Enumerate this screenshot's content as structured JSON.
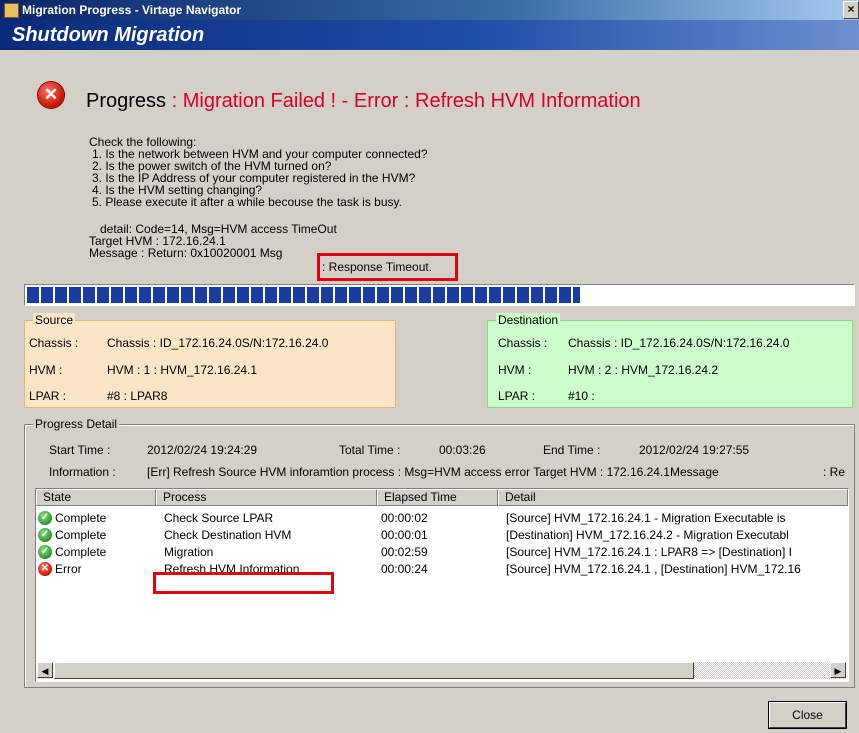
{
  "window": {
    "title": "Migration Progress - Virtage Navigator",
    "close_glyph": "×"
  },
  "banner": {
    "title": "Shutdown Migration"
  },
  "status": {
    "label": "Progress",
    "separator": ":",
    "text": "Migration Failed ! - Error : Refresh HVM Information",
    "error_color": "#d8002a"
  },
  "checklist": {
    "heading": "Check the following:",
    "items": [
      "1. Is the network between HVM and your computer connected?",
      "2. Is the power switch of the HVM turned on?",
      "3. Is the IP Address of your computer registered in the HVM?",
      "4. Is the HVM setting changing?",
      "5. Please execute it after a while becouse the task is busy."
    ]
  },
  "error_detail": {
    "detail": "detail:  Code=14, Msg=HVM access TimeOut",
    "target_hvm": "Target HVM : 172.16.24.1",
    "message_prefix": "Message    : Return: 0x10020001 Msg",
    "message_highlight": ": Response Timeout."
  },
  "progress_bar": {
    "fraction": 0.67,
    "color": "#1a3ba0"
  },
  "source": {
    "legend": "Source",
    "chassis_label": "Chassis :",
    "chassis_value": "Chassis : ID_172.16.24.0S/N:172.16.24.0",
    "hvm_label": "HVM :",
    "hvm_value": "HVM : 1 : HVM_172.16.24.1",
    "lpar_label": "LPAR :",
    "lpar_value": "#8 : LPAR8",
    "bg_color": "#fde6c8"
  },
  "destination": {
    "legend": "Destination",
    "chassis_label": "Chassis :",
    "chassis_value": "Chassis : ID_172.16.24.0S/N:172.16.24.0",
    "hvm_label": "HVM :",
    "hvm_value": "HVM : 2 : HVM_172.16.24.2",
    "lpar_label": "LPAR :",
    "lpar_value": "#10 :",
    "bg_color": "#ccffcc"
  },
  "progress_detail": {
    "legend": "Progress Detail",
    "start_label": "Start Time :",
    "start_value": "2012/02/24 19:24:29",
    "total_label": "Total Time :",
    "total_value": "00:03:26",
    "end_label": "End Time :",
    "end_value": "2012/02/24 19:27:55",
    "info_label": "Information :",
    "info_value": "[Err] Refresh Source HVM inforamtion process : Msg=HVM access error Target HVM : 172.16.24.1Message",
    "info_tail": ": Re"
  },
  "table": {
    "columns": [
      "State",
      "Process",
      "Elapsed Time",
      "Detail"
    ],
    "rows": [
      {
        "state": "Complete",
        "icon": "check-icon",
        "process": "Check Source LPAR",
        "elapsed": "00:00:02",
        "detail": "[Source] HVM_172.16.24.1    - Migration Executable is"
      },
      {
        "state": "Complete",
        "icon": "check-icon",
        "process": "Check Destination HVM",
        "elapsed": "00:00:01",
        "detail": "[Destination] HVM_172.16.24.2    - Migration Executabl"
      },
      {
        "state": "Complete",
        "icon": "check-icon",
        "process": "Migration",
        "elapsed": "00:02:59",
        "detail": "[Source] HVM_172.16.24.1    : LPAR8 => [Destination] I"
      },
      {
        "state": "Error",
        "icon": "error-icon",
        "process": "Refresh HVM Information",
        "elapsed": "00:00:24",
        "detail": "[Source] HVM_172.16.24.1   , [Destination] HVM_172.16"
      }
    ]
  },
  "scrollbar": {
    "left_glyph": "◀",
    "right_glyph": "▶"
  },
  "buttons": {
    "close": "Close"
  }
}
